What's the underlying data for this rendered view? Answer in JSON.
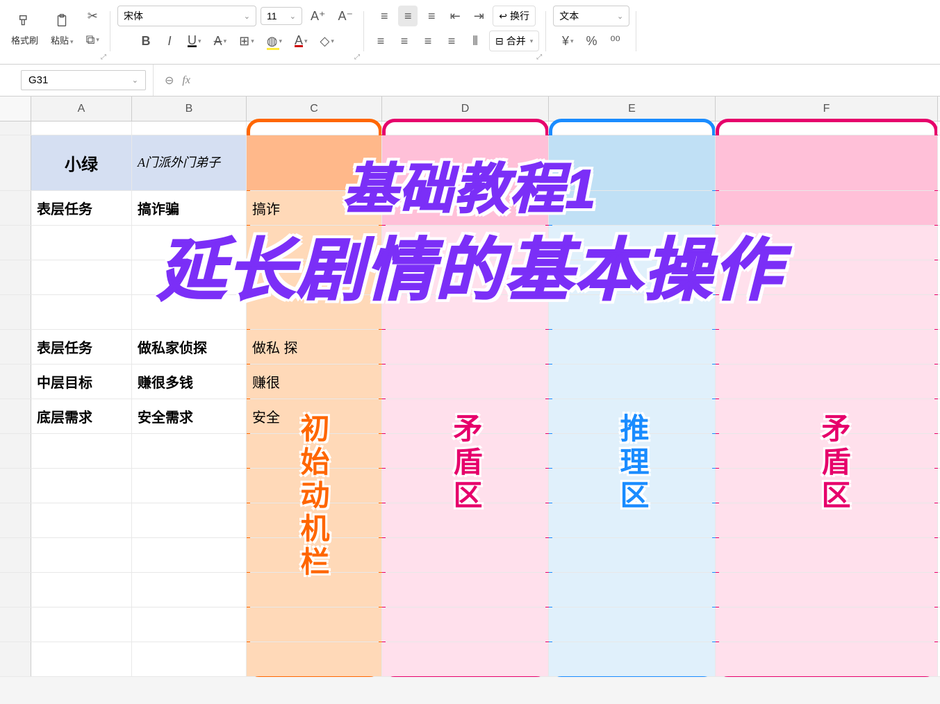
{
  "ribbon": {
    "format_painter": "格式刷",
    "paste": "粘贴",
    "font_name": "宋体",
    "font_size": "11",
    "wrap_text": "换行",
    "merge": "合并",
    "number_format": "文本"
  },
  "formula_bar": {
    "cell_ref": "G31",
    "fx": "fx"
  },
  "columns": [
    "A",
    "B",
    "C",
    "D",
    "E",
    "F"
  ],
  "sheet": {
    "A1": "小绿",
    "B1": "A门派外门弟子",
    "A2": "表层任务",
    "B2": "搞诈骗",
    "C2": "搞诈",
    "A6": "表层任务",
    "B6": "做私家侦探",
    "C6": "做私  探",
    "A7": "中层目标",
    "B7": "赚很多钱",
    "C7": "赚很",
    "A8": "底层需求",
    "B8": "安全需求",
    "C8": "安全"
  },
  "overlay": {
    "title1": "基础教程1",
    "title2": "延长剧情的基本操作",
    "col_C": "初始动机栏",
    "col_D": "矛盾区",
    "col_E": "推理区",
    "col_F": "矛盾区"
  }
}
